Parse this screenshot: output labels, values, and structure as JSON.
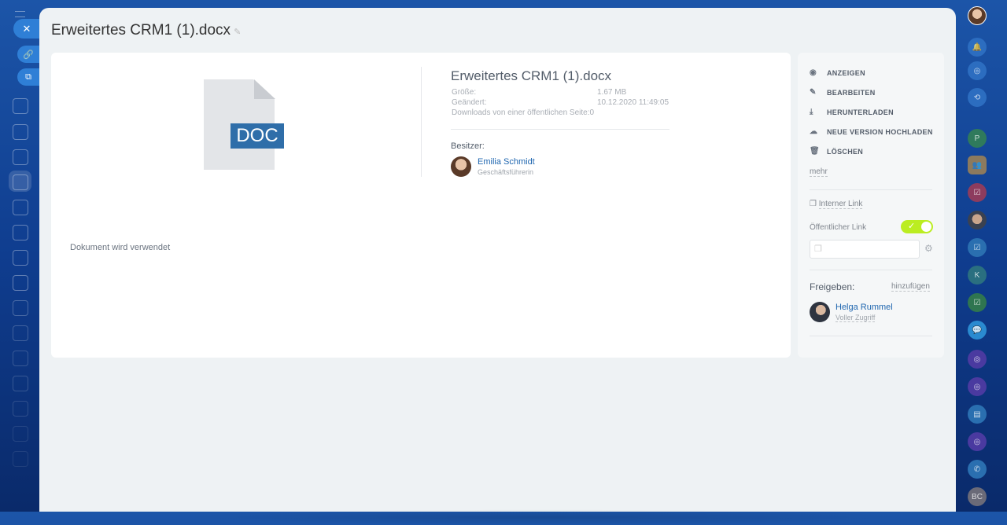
{
  "header": {
    "title": "Erweitertes CRM1 (1).docx"
  },
  "preview": {
    "label": "DOC",
    "status": "Dokument wird verwendet"
  },
  "file": {
    "name": "Erweitertes CRM1 (1).docx",
    "size_label": "Größe:",
    "size": "1.67 MB",
    "modified_label": "Geändert:",
    "modified": "10.12.2020 11:49:05",
    "downloads_label": "Downloads von einer öffentlichen Seite:",
    "downloads": "0"
  },
  "owner": {
    "label": "Besitzer:",
    "name": "Emilia Schmidt",
    "role": "Geschäftsführerin"
  },
  "actions": [
    {
      "label": "ANZEIGEN",
      "icon": "eye-icon"
    },
    {
      "label": "BEARBEITEN",
      "icon": "pencil-icon"
    },
    {
      "label": "HERUNTERLADEN",
      "icon": "download-icon"
    },
    {
      "label": "NEUE VERSION HOCHLADEN",
      "icon": "cloud-upload-icon"
    },
    {
      "label": "LÖSCHEN",
      "icon": "trash-icon"
    }
  ],
  "more": "mehr",
  "internal_link": "Interner Link",
  "public_link": {
    "label": "Öffentlicher Link",
    "enabled": true
  },
  "share": {
    "label": "Freigeben:",
    "add": "hinzufügen",
    "users": [
      {
        "name": "Helga Rummel",
        "access": "Voller Zugriff"
      }
    ]
  },
  "rightbar": {
    "letters": [
      "P",
      "K",
      "BC"
    ]
  },
  "colors": {
    "accent": "#2f7fd6",
    "toggle": "#bbed21",
    "doc": "#2f6ea9"
  }
}
